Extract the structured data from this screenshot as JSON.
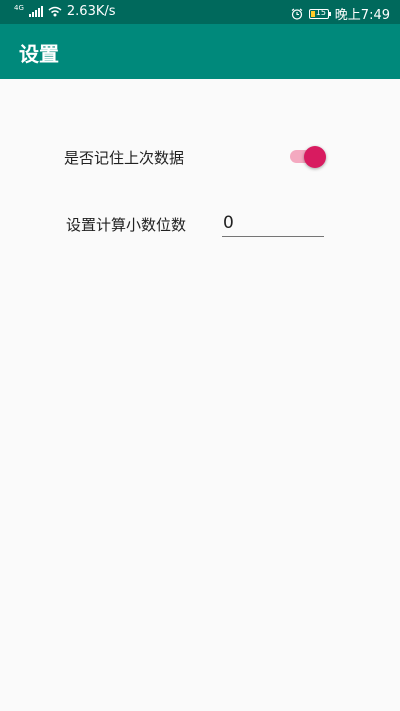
{
  "status_bar": {
    "net_type": "4G",
    "speed": "2.63K/s",
    "battery_level": "15",
    "battery_color": "#ffca28",
    "time": "晚上7:49",
    "icons": [
      "signal-icon",
      "wifi-icon",
      "alarm-icon",
      "battery-icon"
    ]
  },
  "toolbar": {
    "title": "设置",
    "color": "#00897b"
  },
  "settings": {
    "remember_label": "是否记住上次数据",
    "remember_enabled": true,
    "accent_color": "#d81b60",
    "decimal_label": "设置计算小数位数",
    "decimal_value": "0"
  }
}
